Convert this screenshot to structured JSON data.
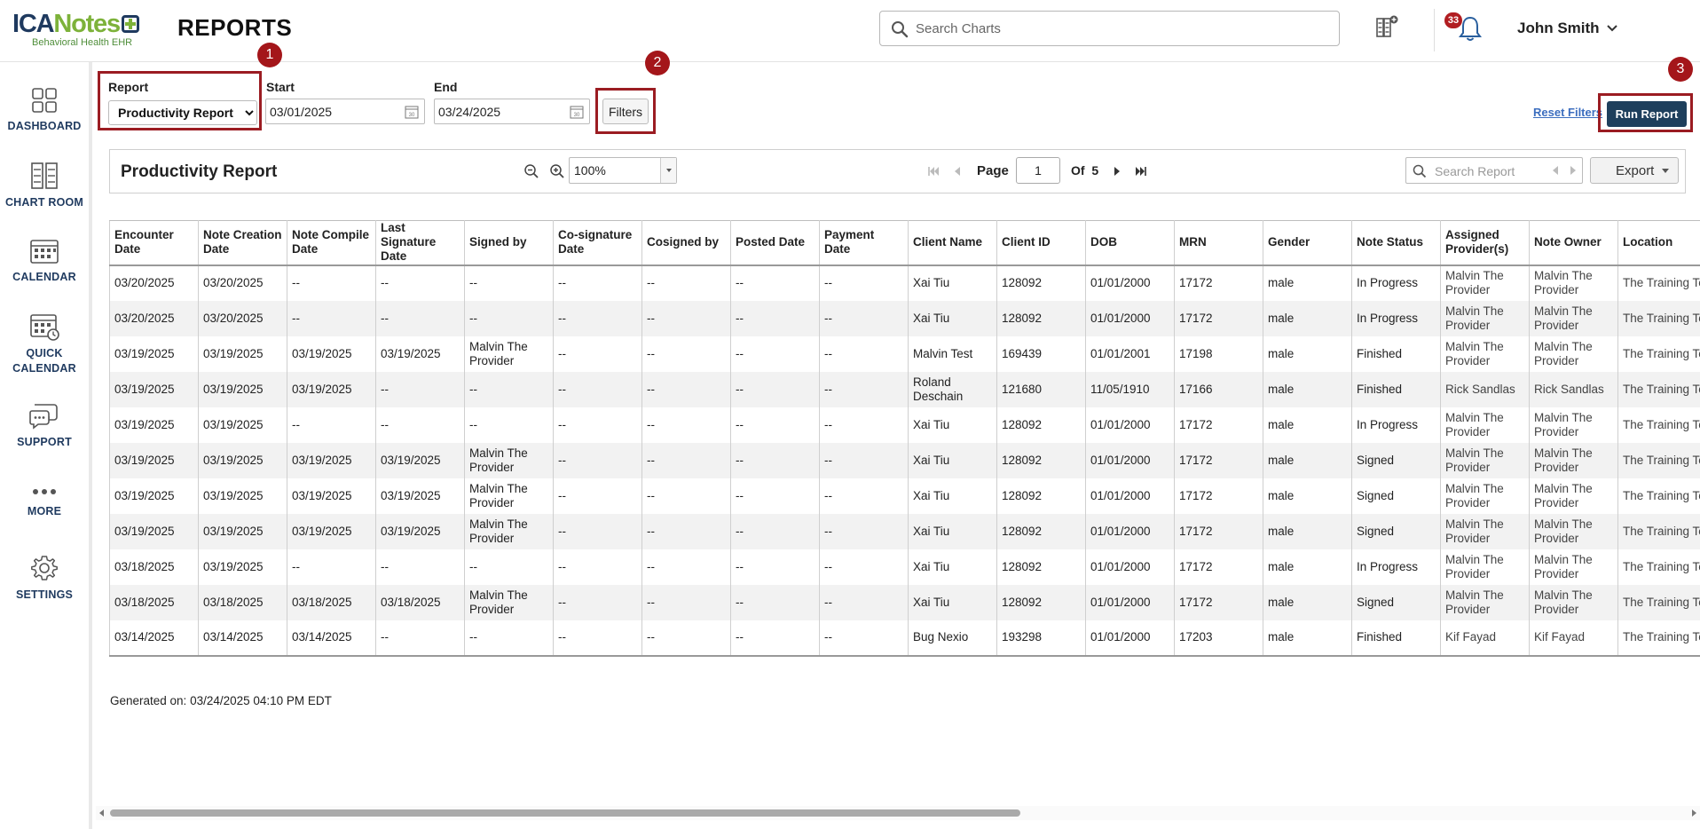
{
  "app": {
    "logo_text_1": "ICA",
    "logo_text_2": "Notes",
    "logo_subtitle": "Behavioral Health EHR",
    "page_title": "REPORTS"
  },
  "header": {
    "search_placeholder": "Search Charts",
    "notification_count": "33",
    "user_name": "John Smith"
  },
  "sidebar": {
    "items": [
      {
        "label": "DASHBOARD",
        "icon": "dashboard-icon"
      },
      {
        "label": "CHART ROOM",
        "icon": "chart-room-icon"
      },
      {
        "label": "CALENDAR",
        "icon": "calendar-icon"
      },
      {
        "label": "QUICK CALENDAR",
        "label_line1": "QUICK",
        "label_line2": "CALENDAR",
        "icon": "quick-calendar-icon"
      },
      {
        "label": "SUPPORT",
        "icon": "support-icon"
      },
      {
        "label": "MORE",
        "icon": "more-icon"
      },
      {
        "label": "SETTINGS",
        "icon": "gear-icon"
      }
    ]
  },
  "controls": {
    "report_label": "Report",
    "report_selected": "Productivity Report",
    "start_label": "Start",
    "start_value": "03/01/2025",
    "end_label": "End",
    "end_value": "03/24/2025",
    "filters_label": "Filters",
    "reset_filters_label": "Reset Filters",
    "run_report_label": "Run Report"
  },
  "steps": [
    "1",
    "2",
    "3"
  ],
  "toolbar": {
    "title": "Productivity Report",
    "zoom_value": "100%",
    "page_label": "Page",
    "page_value": "1",
    "of_label": "Of",
    "total_pages": "5",
    "search_placeholder": "Search Report",
    "export_label": "Export"
  },
  "table": {
    "columns": [
      "Encounter Date",
      "Note Creation Date",
      "Note Compile Date",
      "Last Signature Date",
      "Signed by",
      "Co-signature Date",
      "Cosigned by",
      "Posted Date",
      "Payment Date",
      "Client Name",
      "Client ID",
      "DOB",
      "MRN",
      "Gender",
      "Note Status",
      "Assigned Provider(s)",
      "Note Owner",
      "Location"
    ],
    "rows": [
      [
        "03/20/2025",
        "03/20/2025",
        "--",
        "--",
        "--",
        "--",
        "--",
        "--",
        "--",
        "Xai Tiu",
        "128092",
        "01/01/2000",
        "17172",
        "male",
        "In Progress",
        "Malvin The Provider",
        "Malvin The Provider",
        "The Training Team"
      ],
      [
        "03/20/2025",
        "03/20/2025",
        "--",
        "--",
        "--",
        "--",
        "--",
        "--",
        "--",
        "Xai Tiu",
        "128092",
        "01/01/2000",
        "17172",
        "male",
        "In Progress",
        "Malvin The Provider",
        "Malvin The Provider",
        "The Training Team"
      ],
      [
        "03/19/2025",
        "03/19/2025",
        "03/19/2025",
        "03/19/2025",
        "Malvin The Provider",
        "--",
        "--",
        "--",
        "--",
        "Malvin Test",
        "169439",
        "01/01/2001",
        "17198",
        "male",
        "Finished",
        "Malvin The Provider",
        "Malvin The Provider",
        "The Training Team"
      ],
      [
        "03/19/2025",
        "03/19/2025",
        "03/19/2025",
        "--",
        "--",
        "--",
        "--",
        "--",
        "--",
        "Roland Deschain",
        "121680",
        "11/05/1910",
        "17166",
        "male",
        "Finished",
        "Rick Sandlas",
        "Rick Sandlas",
        "The Training Team"
      ],
      [
        "03/19/2025",
        "03/19/2025",
        "--",
        "--",
        "--",
        "--",
        "--",
        "--",
        "--",
        "Xai Tiu",
        "128092",
        "01/01/2000",
        "17172",
        "male",
        "In Progress",
        "Malvin The Provider",
        "Malvin The Provider",
        "The Training Team"
      ],
      [
        "03/19/2025",
        "03/19/2025",
        "03/19/2025",
        "03/19/2025",
        "Malvin The Provider",
        "--",
        "--",
        "--",
        "--",
        "Xai Tiu",
        "128092",
        "01/01/2000",
        "17172",
        "male",
        "Signed",
        "Malvin The Provider",
        "Malvin The Provider",
        "The Training Team"
      ],
      [
        "03/19/2025",
        "03/19/2025",
        "03/19/2025",
        "03/19/2025",
        "Malvin The Provider",
        "--",
        "--",
        "--",
        "--",
        "Xai Tiu",
        "128092",
        "01/01/2000",
        "17172",
        "male",
        "Signed",
        "Malvin The Provider",
        "Malvin The Provider",
        "The Training Team"
      ],
      [
        "03/19/2025",
        "03/19/2025",
        "03/19/2025",
        "03/19/2025",
        "Malvin The Provider",
        "--",
        "--",
        "--",
        "--",
        "Xai Tiu",
        "128092",
        "01/01/2000",
        "17172",
        "male",
        "Signed",
        "Malvin The Provider",
        "Malvin The Provider",
        "The Training Team"
      ],
      [
        "03/18/2025",
        "03/19/2025",
        "--",
        "--",
        "--",
        "--",
        "--",
        "--",
        "--",
        "Xai Tiu",
        "128092",
        "01/01/2000",
        "17172",
        "male",
        "In Progress",
        "Malvin The Provider",
        "Malvin The Provider",
        "The Training Team"
      ],
      [
        "03/18/2025",
        "03/18/2025",
        "03/18/2025",
        "03/18/2025",
        "Malvin The Provider",
        "--",
        "--",
        "--",
        "--",
        "Xai Tiu",
        "128092",
        "01/01/2000",
        "17172",
        "male",
        "Signed",
        "Malvin The Provider",
        "Malvin The Provider",
        "The Training Team"
      ],
      [
        "03/14/2025",
        "03/14/2025",
        "03/14/2025",
        "--",
        "--",
        "--",
        "--",
        "--",
        "--",
        "Bug Nexio",
        "193298",
        "01/01/2000",
        "17203",
        "male",
        "Finished",
        "Kif Fayad",
        "Kif Fayad",
        "The Training Team"
      ]
    ]
  },
  "footer": {
    "generated_text": "Generated on: 03/24/2025 04:10 PM EDT"
  },
  "colors": {
    "brand_navy": "#1f3a5f",
    "brand_green": "#7db23a",
    "highlight_red": "#9b1c22",
    "run_button": "#1e3f5c",
    "link_blue": "#3c6ebf"
  }
}
